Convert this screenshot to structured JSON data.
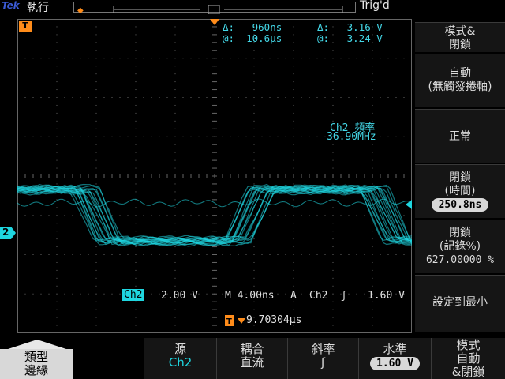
{
  "status": {
    "brand": "Tek",
    "run_state": "執行",
    "trigger_status": "Trig'd"
  },
  "measurements": {
    "delta_time": "Δ:   960ns",
    "at_time": "@:  10.6μs",
    "delta_volt": "Δ:   3.16 V",
    "at_volt": "@:   3.24 V"
  },
  "frequency": {
    "label": "Ch2 頻率",
    "value": "36.90MHz"
  },
  "markers": {
    "channel_ground": "2",
    "trigger_T": "T"
  },
  "settings": {
    "channel": "Ch2",
    "volts_div": "2.00 V",
    "timebase": "M 4.00ns",
    "acq_mode": "A",
    "trig_source": "Ch2",
    "trig_slope": "ʃ",
    "trig_level": "1.60 V",
    "trig_position": "9.70304μs"
  },
  "side_menu": {
    "mode_holdoff": "模式&\n閉鎖",
    "auto": "自動\n(無觸發捲軸)",
    "normal": "正常",
    "holdoff_time_label": "閉鎖\n(時間)",
    "holdoff_time_value": "250.8ns",
    "holdoff_record_label": "閉鎖\n(記錄%)",
    "holdoff_record_value": "627.00000 %",
    "set_min": "設定到最小"
  },
  "bottom_menu": {
    "type": "類型\n邊緣",
    "source_label": "源",
    "source_value": "Ch2",
    "coupling_label": "耦合",
    "coupling_value": "直流",
    "slope_label": "斜率",
    "slope_value": "ʃ",
    "level_label": "水準",
    "level_value": "1.60 V",
    "mode_label": "模式\n自動\n&閉鎖"
  },
  "colors": {
    "waveform": "#1fd6e0",
    "text_cyan": "#44d8e8",
    "trigger_orange": "#ff8c1a",
    "grid": "#4a4a4a"
  },
  "waveform": {
    "channel": "Ch2",
    "high_level_div": 3.65,
    "low_level_div": 2.35,
    "rising_edges_div": [
      6.3,
      0.6
    ],
    "falling_edges_div": [
      1.9,
      9.2
    ],
    "frequency_hz": 36900000
  }
}
